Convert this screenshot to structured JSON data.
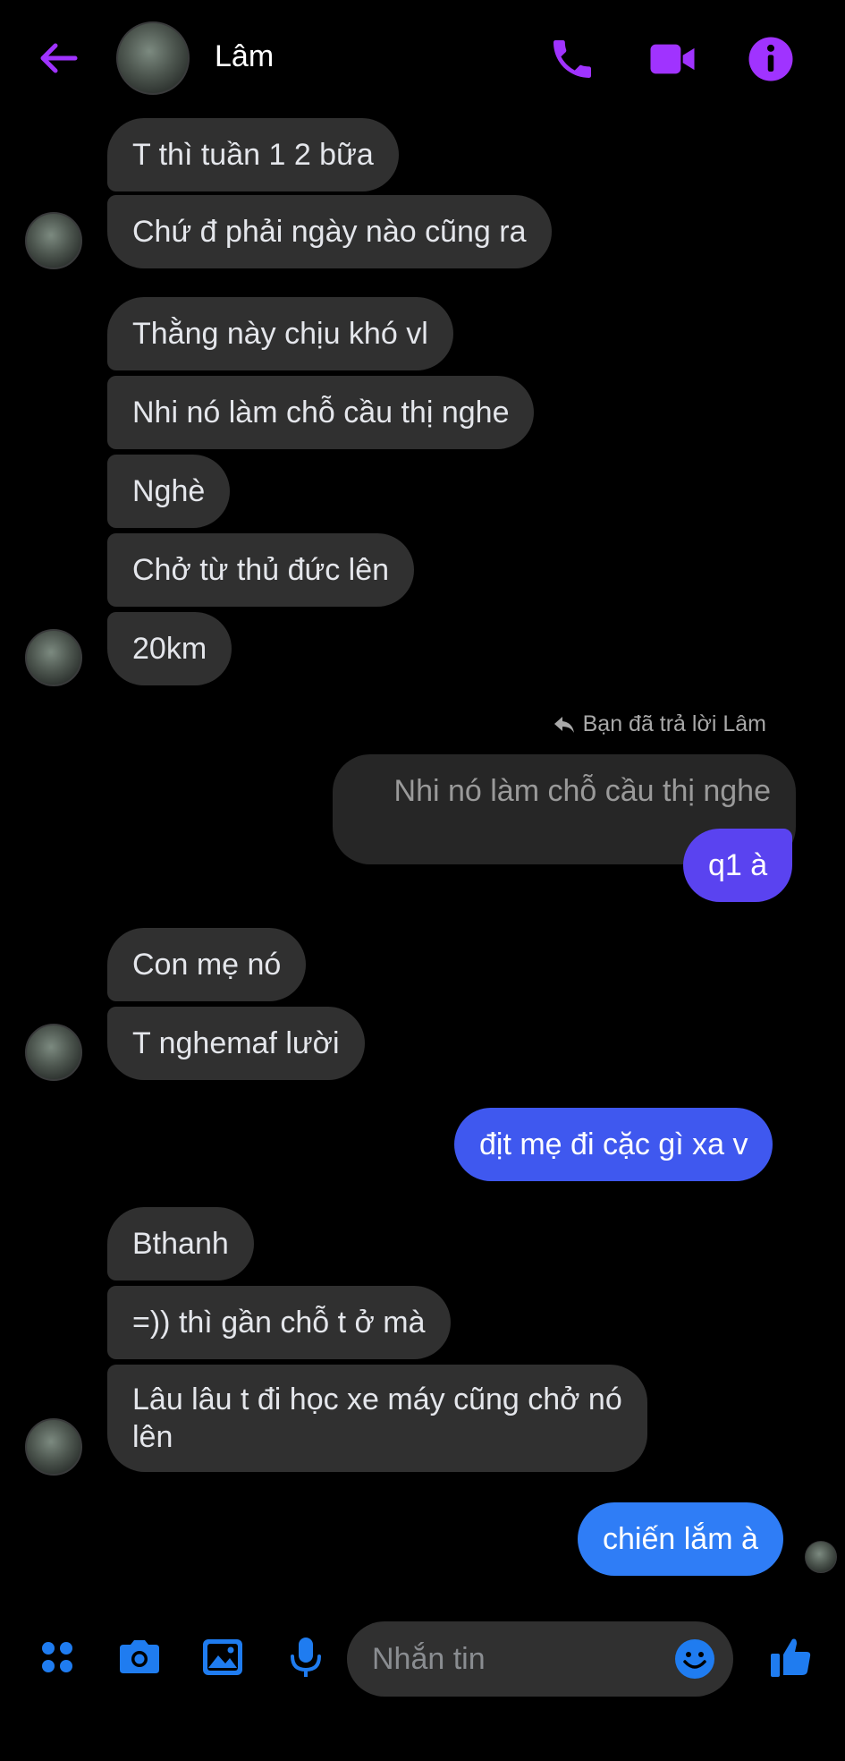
{
  "colors": {
    "accent": "#a033ff",
    "outgoing_blue": "#2f7df6",
    "outgoing_violet": "#5a43f0",
    "incoming": "#303030",
    "composer_blue": "#1f7cf0"
  },
  "header": {
    "contact_name": "Lâm",
    "icons": [
      "back-arrow-icon",
      "phone-icon",
      "video-camera-icon",
      "info-icon"
    ]
  },
  "messages": {
    "m1": "T thì tuần 1 2 bữa",
    "m2": "Chứ đ phải ngày nào cũng ra",
    "m3": "Thằng này chịu khó vl",
    "m4": "Nhi nó làm chỗ cầu thị nghe",
    "m5": "Nghè",
    "m6": "Chở từ thủ đức lên",
    "m7": "20km",
    "reply_context": "Bạn đã trả lời Lâm",
    "quoted": "Nhi nó làm chỗ cầu thị nghe",
    "m8": "q1 à",
    "m9": "Con mẹ nó",
    "m10": "T nghemaf lười",
    "m11": "địt mẹ đi cặc gì xa v",
    "m12": "Bthanh",
    "m13": "=)) thì gần chỗ t ở mà",
    "m14_line1": "Lâu lâu t đi học xe máy cũng chở nó",
    "m14_line2": "lên",
    "m15": "chiến lắm à"
  },
  "composer": {
    "placeholder": "Nhắn tin",
    "icons": [
      "apps-grid-icon",
      "camera-icon",
      "image-icon",
      "microphone-icon",
      "emoji-icon",
      "thumbs-up-icon"
    ]
  }
}
